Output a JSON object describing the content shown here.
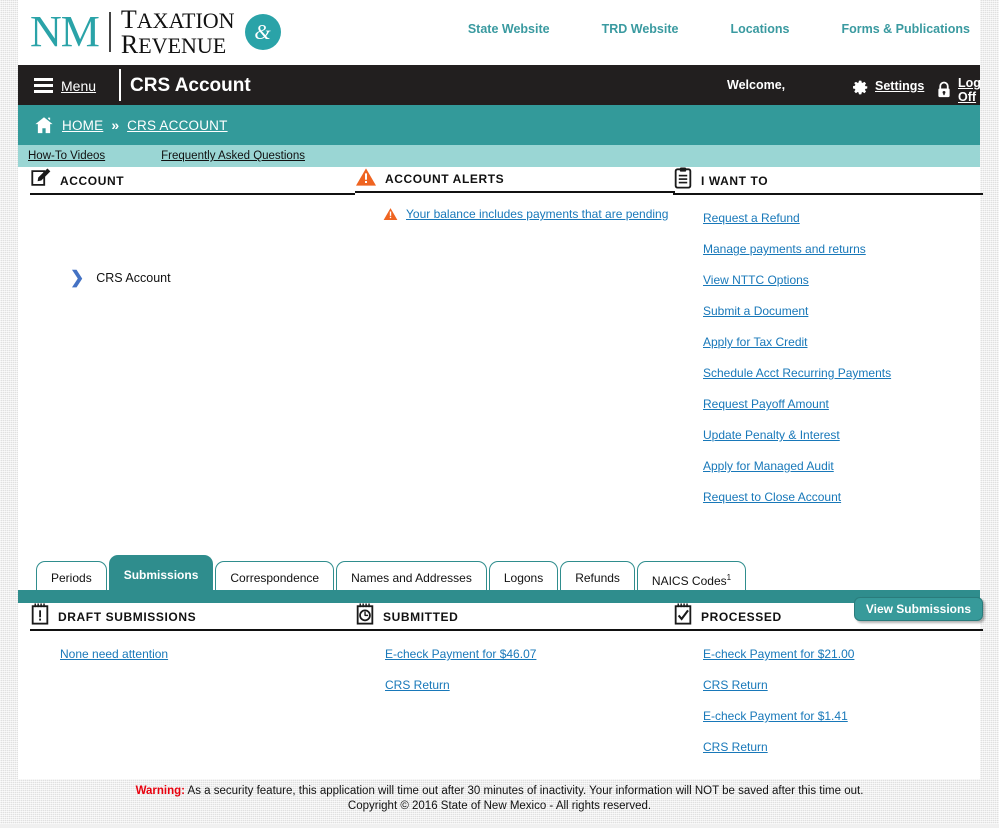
{
  "brand": {
    "nm": "NM",
    "word_line1": "Taxation",
    "word_line2": "Revenue",
    "ampersand": "&",
    "teal": "#2aa3a8"
  },
  "top_nav": [
    {
      "label": "State Website",
      "name": "state-website"
    },
    {
      "label": "TRD Website",
      "name": "trd-website"
    },
    {
      "label": "Locations",
      "name": "locations"
    },
    {
      "label": "Forms & Publications",
      "name": "forms-publications"
    }
  ],
  "darkbar": {
    "menu_label": "Menu",
    "page_title": "CRS Account",
    "welcome": "Welcome,",
    "settings_label": "Settings",
    "logoff_label": "Log Off",
    "background": "#221f1f"
  },
  "breadcrumb": {
    "home": "HOME",
    "separator": "»",
    "current": "CRS ACCOUNT",
    "background": "#339a9a"
  },
  "subbar": {
    "links": [
      {
        "label": "How-To Videos",
        "name": "how-to-videos"
      },
      {
        "label": "Frequently Asked Questions",
        "name": "frequently-asked-questions"
      }
    ],
    "background": "#9ad6d4"
  },
  "account_panel": {
    "title": "ACCOUNT",
    "icon": "edit-note-icon",
    "tree_item": "CRS Account"
  },
  "alerts_panel": {
    "title": "ACCOUNT ALERTS",
    "icon": "warning-triangle-icon",
    "alerts": [
      {
        "label": "Your balance includes payments that are pending"
      }
    ]
  },
  "i_want_to_panel": {
    "title": "I WANT TO",
    "icon": "clipboard-icon",
    "links": [
      {
        "label": "Request a Refund"
      },
      {
        "label": "Manage payments and returns"
      },
      {
        "label": "View NTTC Options"
      },
      {
        "label": "Submit a Document"
      },
      {
        "label": "Apply for Tax Credit"
      },
      {
        "label": "Schedule Acct Recurring Payments"
      },
      {
        "label": "Request Payoff Amount"
      },
      {
        "label": "Update Penalty & Interest"
      },
      {
        "label": "Apply for Managed Audit"
      },
      {
        "label": "Request to Close Account"
      }
    ]
  },
  "tabs": [
    {
      "label": "Periods",
      "active": false
    },
    {
      "label": "Submissions",
      "active": true
    },
    {
      "label": "Correspondence",
      "active": false
    },
    {
      "label": "Names and Addresses",
      "active": false
    },
    {
      "label": "Logons",
      "active": false
    },
    {
      "label": "Refunds",
      "active": false
    },
    {
      "label": "NAICS Codes",
      "sup": "1",
      "active": false
    }
  ],
  "draft_panel": {
    "title": "DRAFT SUBMISSIONS",
    "icon": "notepad-exclamation-icon",
    "links": [
      {
        "label": "None need attention"
      }
    ]
  },
  "submitted_panel": {
    "title": "SUBMITTED",
    "icon": "notepad-clock-icon",
    "links": [
      {
        "label": "E-check Payment for $46.07"
      },
      {
        "label": "CRS Return"
      }
    ]
  },
  "processed_panel": {
    "title": "PROCESSED",
    "icon": "notepad-check-icon",
    "button_label": "View Submissions",
    "links": [
      {
        "label": "E-check Payment for $21.00"
      },
      {
        "label": "CRS Return"
      },
      {
        "label": "E-check Payment for $1.41"
      },
      {
        "label": "CRS Return"
      }
    ]
  },
  "footer": {
    "warning_label": "Warning:",
    "warning_text": " As a security feature, this application will time out after 30 minutes of inactivity. Your information will NOT be saved after this time out.",
    "copyright": "Copyright © 2016 State of New Mexico - All rights reserved."
  },
  "colors": {
    "teal": "#339a9a",
    "teal_light": "#9ad6d4",
    "link_blue": "#1878b9",
    "warn_orange": "#ef6421",
    "warn_red": "#e8000d"
  }
}
